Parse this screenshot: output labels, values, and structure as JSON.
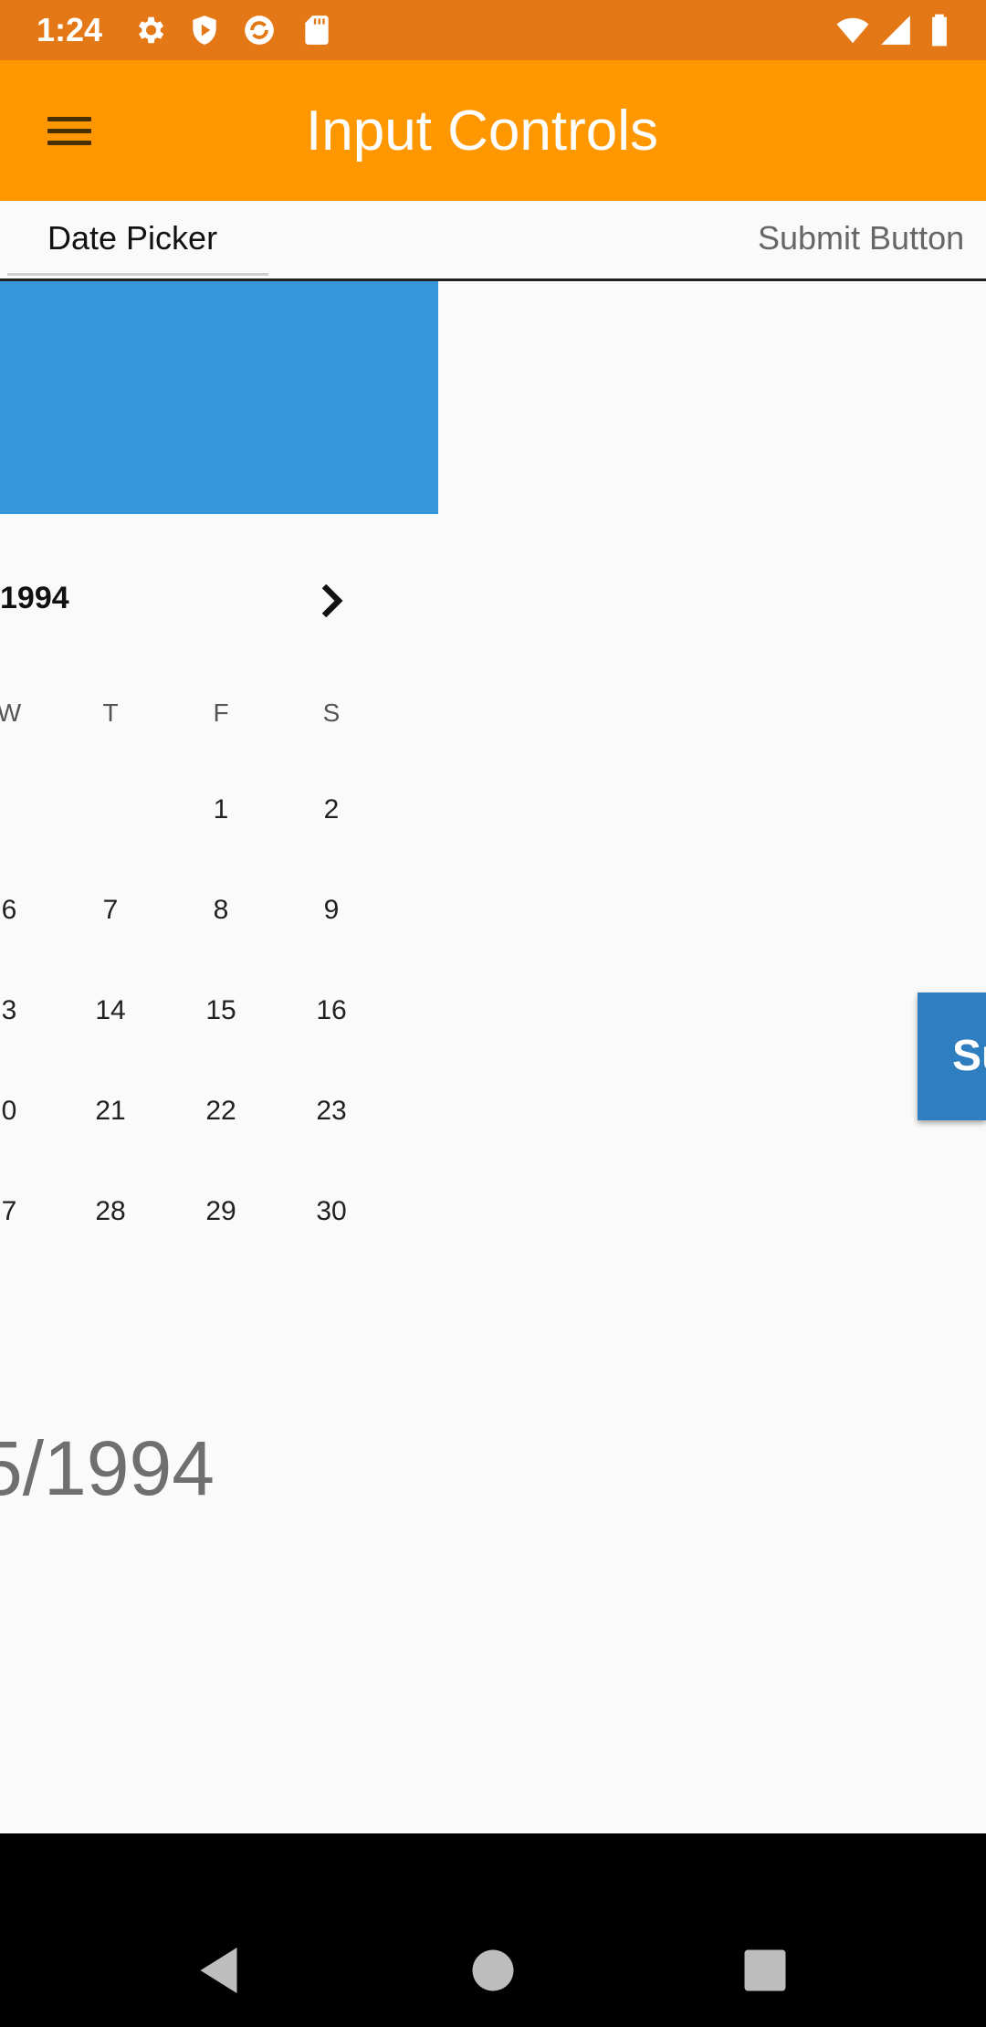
{
  "status_bar": {
    "time": "1:24",
    "icons": [
      "gear-icon",
      "shield-play-icon",
      "sync-icon",
      "sd-card-icon",
      "wifi-icon",
      "cell-signal-icon",
      "battery-icon"
    ],
    "background": "#e47816"
  },
  "app_bar": {
    "title": "Input Controls",
    "menu_icon": "hamburger-menu-icon",
    "background": "#ff9800"
  },
  "tabs": [
    {
      "label": "Date Picker",
      "selected": true
    },
    {
      "label": "Submit Button",
      "selected": false
    }
  ],
  "date_picker": {
    "header_color": "#3596d9",
    "month_year": "1994",
    "next_icon": "chevron-right-icon",
    "weekday_headers": [
      "W",
      "T",
      "F",
      "S"
    ],
    "weeks": [
      [
        "",
        "",
        "1",
        "2"
      ],
      [
        "6",
        "7",
        "8",
        "9"
      ],
      [
        "3",
        "14",
        "15",
        "16"
      ],
      [
        "0",
        "21",
        "22",
        "23"
      ],
      [
        "7",
        "28",
        "29",
        "30"
      ]
    ],
    "selected_date_text": "5/1994"
  },
  "submit_button": {
    "label": "Su",
    "color": "#2f7fc0"
  },
  "nav_bar": {
    "buttons": [
      "back-icon",
      "home-icon",
      "recents-icon"
    ]
  }
}
